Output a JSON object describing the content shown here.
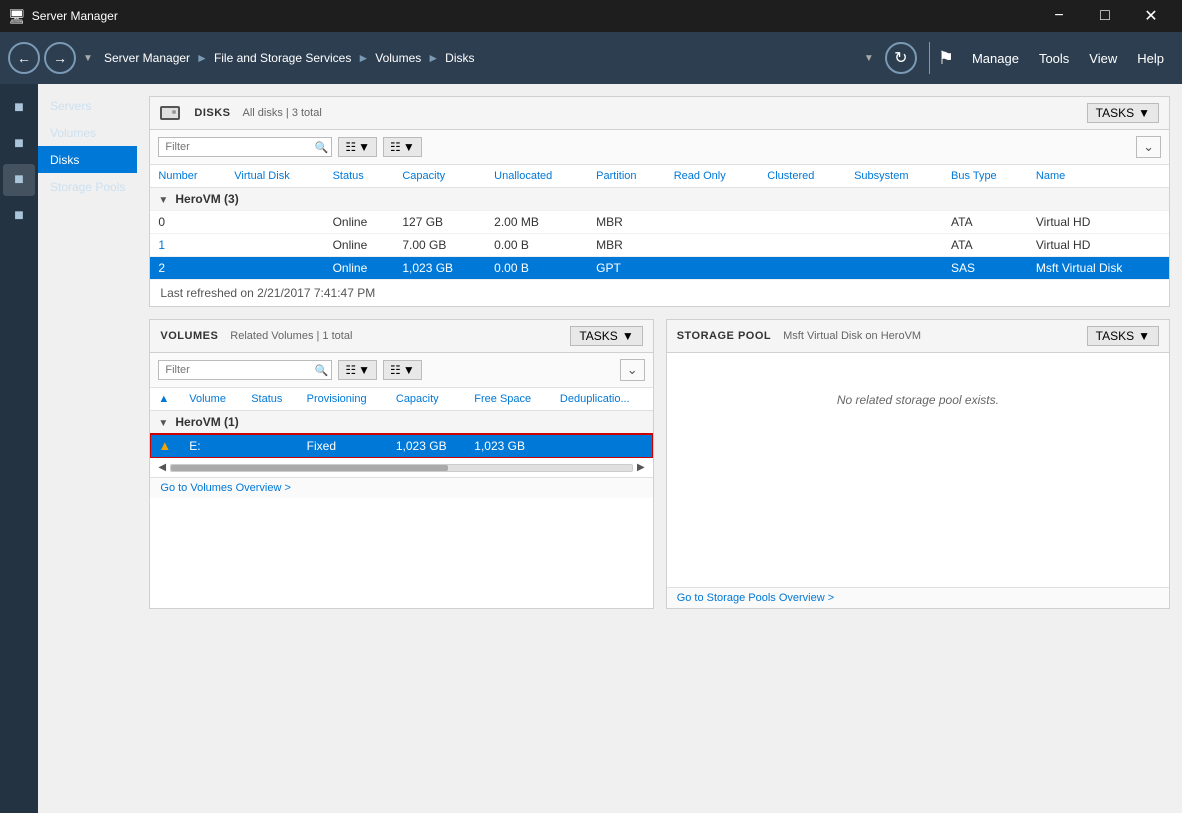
{
  "titleBar": {
    "icon": "🖥",
    "title": "Server Manager",
    "minimizeLabel": "−",
    "maximizeLabel": "□",
    "closeLabel": "✕"
  },
  "navBar": {
    "breadcrumb": {
      "parts": [
        {
          "label": "Server Manager",
          "link": true
        },
        {
          "label": "File and Storage Services",
          "link": true
        },
        {
          "label": "Volumes",
          "link": true
        },
        {
          "label": "Disks",
          "link": false
        }
      ]
    },
    "menuItems": [
      "Manage",
      "Tools",
      "View",
      "Help"
    ]
  },
  "sidebar": {
    "items": [
      {
        "label": "Servers",
        "active": false
      },
      {
        "label": "Volumes",
        "active": false
      },
      {
        "label": "Disks",
        "active": true
      },
      {
        "label": "Storage Pools",
        "active": false
      }
    ]
  },
  "disksPanel": {
    "title": "DISKS",
    "subtitle": "All disks | 3 total",
    "tasksLabel": "TASKS",
    "filterPlaceholder": "Filter",
    "columns": [
      "Number",
      "Virtual Disk",
      "Status",
      "Capacity",
      "Unallocated",
      "Partition",
      "Read Only",
      "Clustered",
      "Subsystem",
      "Bus Type",
      "Name"
    ],
    "groups": [
      {
        "name": "HeroVM (3)",
        "rows": [
          {
            "number": "0",
            "virtualDisk": "",
            "status": "Online",
            "capacity": "127 GB",
            "unallocated": "2.00 MB",
            "partition": "MBR",
            "readOnly": "",
            "clustered": "",
            "subsystem": "",
            "busType": "ATA",
            "name": "Virtual HD",
            "selected": false,
            "link": false
          },
          {
            "number": "1",
            "virtualDisk": "",
            "status": "Online",
            "capacity": "7.00 GB",
            "unallocated": "0.00 B",
            "partition": "MBR",
            "readOnly": "",
            "clustered": "",
            "subsystem": "",
            "busType": "ATA",
            "name": "Virtual HD",
            "selected": false,
            "link": true
          },
          {
            "number": "2",
            "virtualDisk": "",
            "status": "Online",
            "capacity": "1,023 GB",
            "unallocated": "0.00 B",
            "partition": "GPT",
            "readOnly": "",
            "clustered": "",
            "subsystem": "",
            "busType": "SAS",
            "name": "Msft Virtual Disk",
            "selected": true,
            "link": false
          }
        ]
      }
    ],
    "refreshNote": "Last refreshed on 2/21/2017 7:41:47 PM"
  },
  "volumesPanel": {
    "title": "VOLUMES",
    "subtitle": "Related Volumes | 1 total",
    "tasksLabel": "TASKS",
    "filterPlaceholder": "Filter",
    "columns": [
      "",
      "Volume",
      "Status",
      "Provisioning",
      "Capacity",
      "Free Space",
      "Deduplicatio..."
    ],
    "groups": [
      {
        "name": "HeroVM (1)",
        "rows": [
          {
            "warning": true,
            "volume": "E:",
            "status": "",
            "provisioning": "Fixed",
            "capacity": "1,023 GB",
            "freeSpace": "1,023 GB",
            "dedup": "",
            "selected": true
          }
        ]
      }
    ],
    "gotoLink": "Go to Volumes Overview >"
  },
  "storagePoolPanel": {
    "title": "STORAGE POOL",
    "subtitle": "Msft Virtual Disk on HeroVM",
    "tasksLabel": "TASKS",
    "emptyMessage": "No related storage pool exists.",
    "gotoLink": "Go to Storage Pools Overview >"
  }
}
